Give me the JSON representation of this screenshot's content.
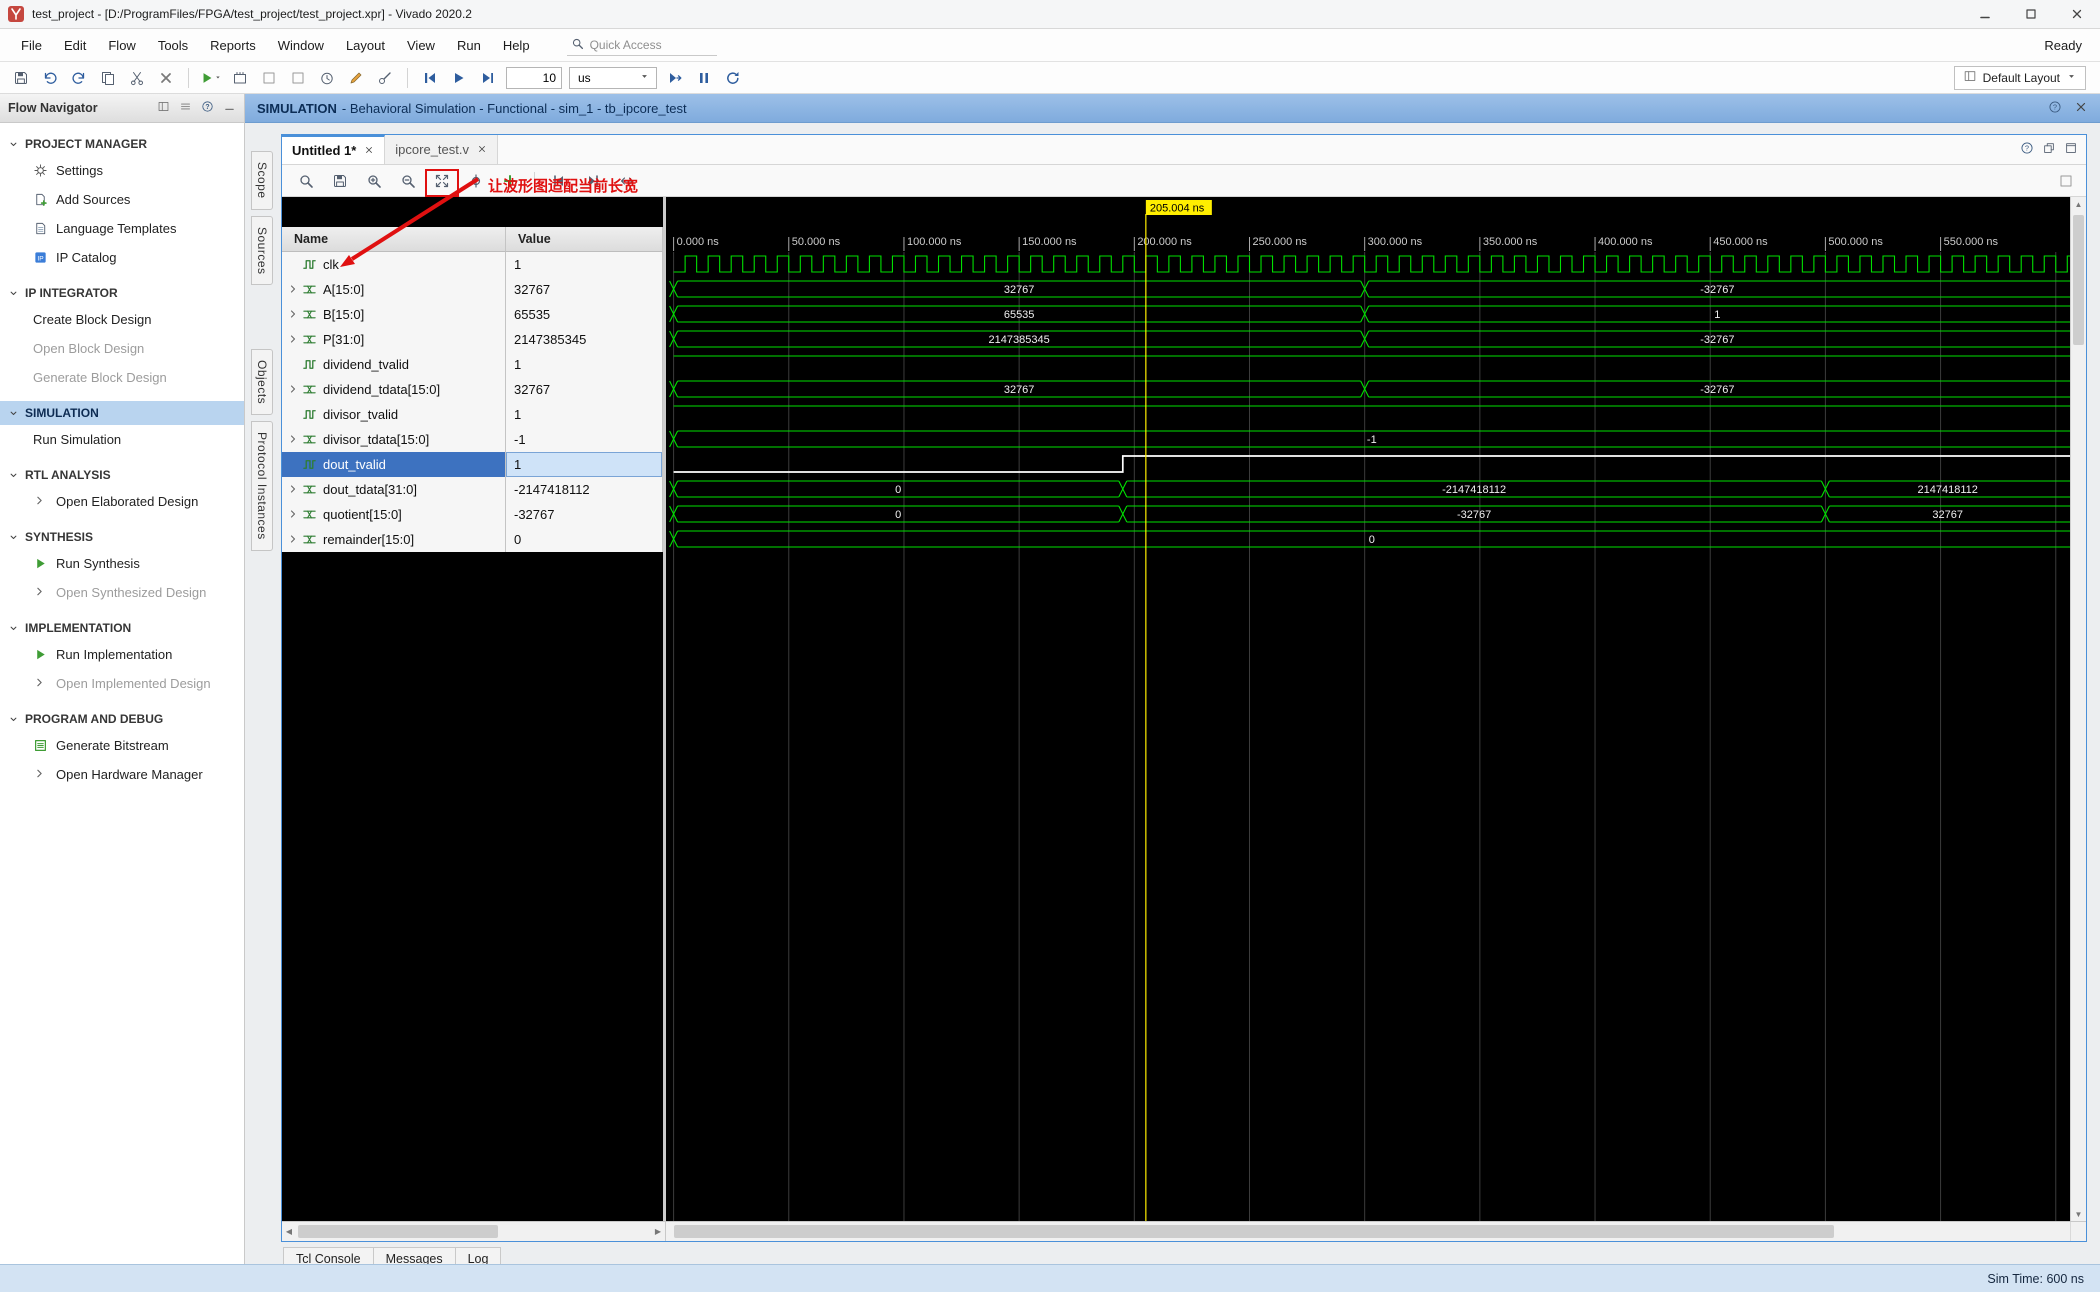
{
  "window": {
    "title": "test_project - [D:/ProgramFiles/FPGA/test_project/test_project.xpr] - Vivado 2020.2",
    "controls": [
      "minimize",
      "maximize",
      "close"
    ]
  },
  "menubar": {
    "items": [
      "File",
      "Edit",
      "Flow",
      "Tools",
      "Reports",
      "Window",
      "Layout",
      "View",
      "Run",
      "Help"
    ],
    "quick_access": "Quick Access",
    "ready": "Ready"
  },
  "toolbar": {
    "icons_before_time": [
      "save",
      "undo",
      "redo",
      "copy",
      "cut",
      "delete",
      "sep",
      "run-flow",
      "dashboard",
      "settings",
      "reports",
      "timer",
      "edit",
      "debug",
      "sep",
      "restart",
      "run-all",
      "run-for"
    ],
    "run_time_value": "10",
    "run_time_unit": "us",
    "icons_after_time": [
      "step",
      "break",
      "relaunch"
    ],
    "layout_selector": "Default Layout"
  },
  "context_bar": {
    "title_strong": "SIMULATION",
    "title_rest": "- Behavioral Simulation - Functional - sim_1 - tb_ipcore_test",
    "icons": [
      "help",
      "close"
    ]
  },
  "flow_navigator": {
    "title": "Flow Navigator",
    "header_icons": [
      "layout-toggle",
      "collapse-all",
      "help",
      "minimize-panel"
    ],
    "sections": [
      {
        "label": "PROJECT MANAGER",
        "items": [
          {
            "label": "Settings",
            "icon": "gear"
          },
          {
            "label": "Add Sources",
            "icon": "add-sources"
          },
          {
            "label": "Language Templates",
            "icon": "doc"
          },
          {
            "label": "IP Catalog",
            "icon": "ip"
          }
        ]
      },
      {
        "label": "IP INTEGRATOR",
        "items": [
          {
            "label": "Create Block Design"
          },
          {
            "label": "Open Block Design",
            "disabled": true
          },
          {
            "label": "Generate Block Design",
            "disabled": true
          }
        ]
      },
      {
        "label": "SIMULATION",
        "selected": true,
        "items": [
          {
            "label": "Run Simulation"
          }
        ]
      },
      {
        "label": "RTL ANALYSIS",
        "items": [
          {
            "label": "Open Elaborated Design",
            "chevron": true
          }
        ]
      },
      {
        "label": "SYNTHESIS",
        "items": [
          {
            "label": "Run Synthesis",
            "icon": "run-green"
          },
          {
            "label": "Open Synthesized Design",
            "chevron": true,
            "disabled": true
          }
        ]
      },
      {
        "label": "IMPLEMENTATION",
        "items": [
          {
            "label": "Run Implementation",
            "icon": "run-green"
          },
          {
            "label": "Open Implemented Design",
            "chevron": true,
            "disabled": true
          }
        ]
      },
      {
        "label": "PROGRAM AND DEBUG",
        "items": [
          {
            "label": "Generate Bitstream",
            "icon": "bitstream"
          },
          {
            "label": "Open Hardware Manager",
            "chevron": true
          }
        ]
      }
    ]
  },
  "side_tabs": [
    "Scope",
    "Sources",
    "Objects",
    "Protocol Instances"
  ],
  "editor_tabs": [
    {
      "label": "Untitled 1*",
      "active": true
    },
    {
      "label": "ipcore_test.v",
      "active": false
    }
  ],
  "panel_icons": [
    "help",
    "float",
    "maximize"
  ],
  "wave_toolbar": {
    "icons": [
      "find",
      "save",
      "zoom-in",
      "zoom-out",
      "zoom-fit",
      "zoom-cursor",
      "add-marker",
      "goto-start",
      "goto-end",
      "swap-cursor"
    ],
    "settings_icon": "settings",
    "annotation": "让波形图适配当前长宽"
  },
  "wave": {
    "columns": {
      "name": "Name",
      "value": "Value"
    },
    "cursor": {
      "time_ns": 205.004,
      "label": "205.004 ns"
    },
    "ruler": {
      "major_step_ns": 50,
      "labels": [
        "0.000 ns",
        "50.000 ns",
        "100.000 ns",
        "150.000 ns",
        "200.000 ns",
        "250.000 ns",
        "300.000 ns",
        "350.000 ns",
        "400.000 ns",
        "450.000 ns",
        "500.000 ns",
        "550.000 ns"
      ]
    },
    "signals": [
      {
        "name": "clk",
        "value": "1",
        "type": "clock",
        "period_ns": 10
      },
      {
        "name": "A[15:0]",
        "value": "32767",
        "type": "bus",
        "segments": [
          {
            "t": 0,
            "label": "32767"
          },
          {
            "t": 300,
            "label": "-32767"
          }
        ]
      },
      {
        "name": "B[15:0]",
        "value": "65535",
        "type": "bus",
        "segments": [
          {
            "t": 0,
            "label": "65535"
          },
          {
            "t": 300,
            "label": "1"
          }
        ]
      },
      {
        "name": "P[31:0]",
        "value": "2147385345",
        "type": "bus",
        "segments": [
          {
            "t": 0,
            "label": "2147385345"
          },
          {
            "t": 300,
            "label": "-32767"
          }
        ]
      },
      {
        "name": "dividend_tvalid",
        "value": "1",
        "type": "bit",
        "initial": 1,
        "edges": []
      },
      {
        "name": "dividend_tdata[15:0]",
        "value": "32767",
        "type": "bus",
        "segments": [
          {
            "t": 0,
            "label": "32767"
          },
          {
            "t": 300,
            "label": "-32767"
          }
        ]
      },
      {
        "name": "divisor_tvalid",
        "value": "1",
        "type": "bit",
        "initial": 1,
        "edges": []
      },
      {
        "name": "divisor_tdata[15:0]",
        "value": "-1",
        "type": "bus",
        "segments": [
          {
            "t": 0,
            "label": "-1"
          }
        ]
      },
      {
        "name": "dout_tvalid",
        "value": "1",
        "type": "bit",
        "initial": 0,
        "edges": [
          195
        ],
        "selected": true
      },
      {
        "name": "dout_tdata[31:0]",
        "value": "-2147418112",
        "type": "bus",
        "segments": [
          {
            "t": 0,
            "label": "0"
          },
          {
            "t": 195,
            "label": "-2147418112"
          },
          {
            "t": 500,
            "label": "2147418112"
          }
        ]
      },
      {
        "name": "quotient[15:0]",
        "value": "-32767",
        "type": "bus",
        "segments": [
          {
            "t": 0,
            "label": "0"
          },
          {
            "t": 195,
            "label": "-32767"
          },
          {
            "t": 500,
            "label": "32767"
          }
        ]
      },
      {
        "name": "remainder[15:0]",
        "value": "0",
        "type": "bus",
        "segments": [
          {
            "t": 0,
            "label": "0"
          }
        ]
      }
    ]
  },
  "console_tabs": [
    "Tcl Console",
    "Messages",
    "Log"
  ],
  "status_bar": {
    "sim_time": "Sim Time: 600 ns"
  },
  "colors": {
    "wave_green": "#00e000",
    "selected_wave": "#ffffff",
    "cursor_yellow": "#ffee00",
    "annotation_red": "#e01010",
    "context_blue": "#8db7e6"
  }
}
